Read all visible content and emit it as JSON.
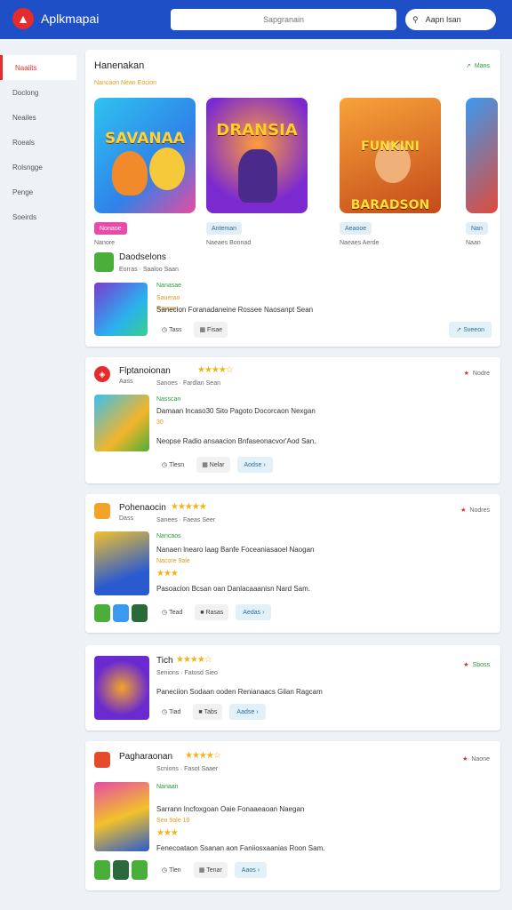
{
  "header": {
    "brand": "Aplkmapai",
    "search_placeholder": "Sapgranain",
    "search_button": "Aapn lsan"
  },
  "sidebar": {
    "items": [
      "Naaiits",
      "Doclong",
      "Neailes",
      "Roeals",
      "Rolsngge",
      "Penge",
      "Soeirds"
    ]
  },
  "featured": {
    "title": "Hanenakan",
    "tags": "Nancaon   Nean Eocion",
    "badge": "Mans",
    "banners": [
      "SAVANAA",
      "DRANSIA",
      "FUNKINI BARADSON",
      ""
    ],
    "chips": [
      {
        "label": "Nonaoe",
        "sub": "Nanore"
      },
      {
        "label": "Anteman",
        "sub": "Naeaes Bonnad"
      },
      {
        "label": "Aeaooe",
        "sub": "Naeaes Aerde"
      },
      {
        "label": "Nan",
        "sub": "Naan"
      }
    ],
    "app": {
      "name": "Daodselons",
      "meta": "Eorras · Saaloo Saan",
      "tag1": "Nanasae",
      "tag2": "Sauerao",
      "tag3": "Rausan",
      "promo": "Sanecion Foranadaneine Rossee Naosanpt Sean",
      "btn1": "Tass",
      "btn2": "Fisae",
      "get": "Sveeon"
    }
  },
  "apps": [
    {
      "name": "Flptanoionan",
      "sub": "Aass",
      "meta": "Sanoes · Fardlan Sean",
      "tag1": "Nasscan",
      "line1": "Damaan lncaso30 Sito Pagoto Docorcaon Nexgan",
      "rating": "30",
      "line2": "Neopse Radio ansaacion Bnfaseonacvor'Aod San.",
      "btn1": "Tlesn",
      "btn2": "Nelar",
      "get": "Aodse",
      "badge": "Nodre"
    },
    {
      "name": "Pohenaocin",
      "sub": "Dass",
      "meta": "Sanees · Faeas Seer",
      "tag1": "Nancaos",
      "line1": "Nanaen lnearo laag Banfe Foceaniasaoel Naogan",
      "rating": "Nacore 9ale",
      "line2": "Pasoacion Bcsan oan Danlacaaanisn Nard Sam.",
      "btn1": "Tead",
      "btn2": "Rasas",
      "get": "Aedas",
      "badge": "Nodres"
    },
    {
      "name": "Tich",
      "sub": "",
      "meta": "Senions · Fatosd Sieo",
      "line2": "Paneciion Sodaan ooden Renianaacs Gilan Ragcam",
      "btn1": "Tiad",
      "btn2": "Tabs",
      "get": "Aadse",
      "badge": "Sboss"
    },
    {
      "name": "Pagharaonan",
      "sub": "",
      "meta": "Scnions · Fasot Saaer",
      "tag1": "Nanaan",
      "line1": "Sarrann Incfoxgoan Oaie Fonaaeaoan Naegan",
      "rating": "Sen 9ale 10",
      "line2": "Fenecoataon Ssanan aon Faniiosxaanias Roon Sam.",
      "btn1": "Tlen",
      "btn2": "Tenar",
      "get": "Aaos",
      "badge": "Naone"
    }
  ]
}
